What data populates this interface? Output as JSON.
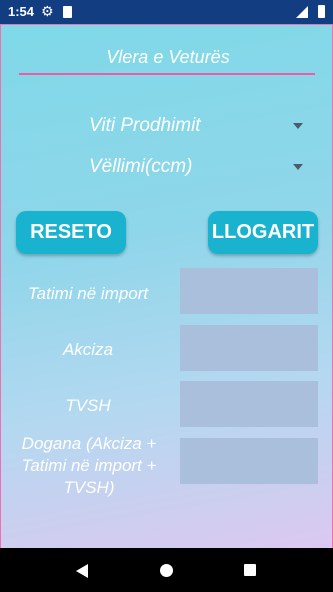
{
  "status_bar": {
    "time": "1:54",
    "icons": [
      "gear-icon",
      "sdcard-icon",
      "signal-icon",
      "battery-icon"
    ]
  },
  "app": {
    "title": "Vlera e Veturës",
    "spinners": [
      {
        "value": "Viti Prodhimit"
      },
      {
        "value": "Vëllimi(ccm)"
      }
    ],
    "buttons": {
      "reset": "RESETO",
      "calculate": "LLOGARIT"
    },
    "fields": [
      {
        "label": "Tatimi në import",
        "value": ""
      },
      {
        "label": "Akciza",
        "value": ""
      },
      {
        "label": "TVSH",
        "value": ""
      },
      {
        "label": "Dogana (Akciza + Tatimi në import + TVSH)",
        "value": ""
      }
    ],
    "colors": {
      "accent": "#19b3cf",
      "underline": "#f05aa8",
      "field_bg": "#a9bfdc"
    }
  },
  "nav_bar": {
    "icons": [
      "back-icon",
      "home-icon",
      "recents-icon"
    ]
  }
}
